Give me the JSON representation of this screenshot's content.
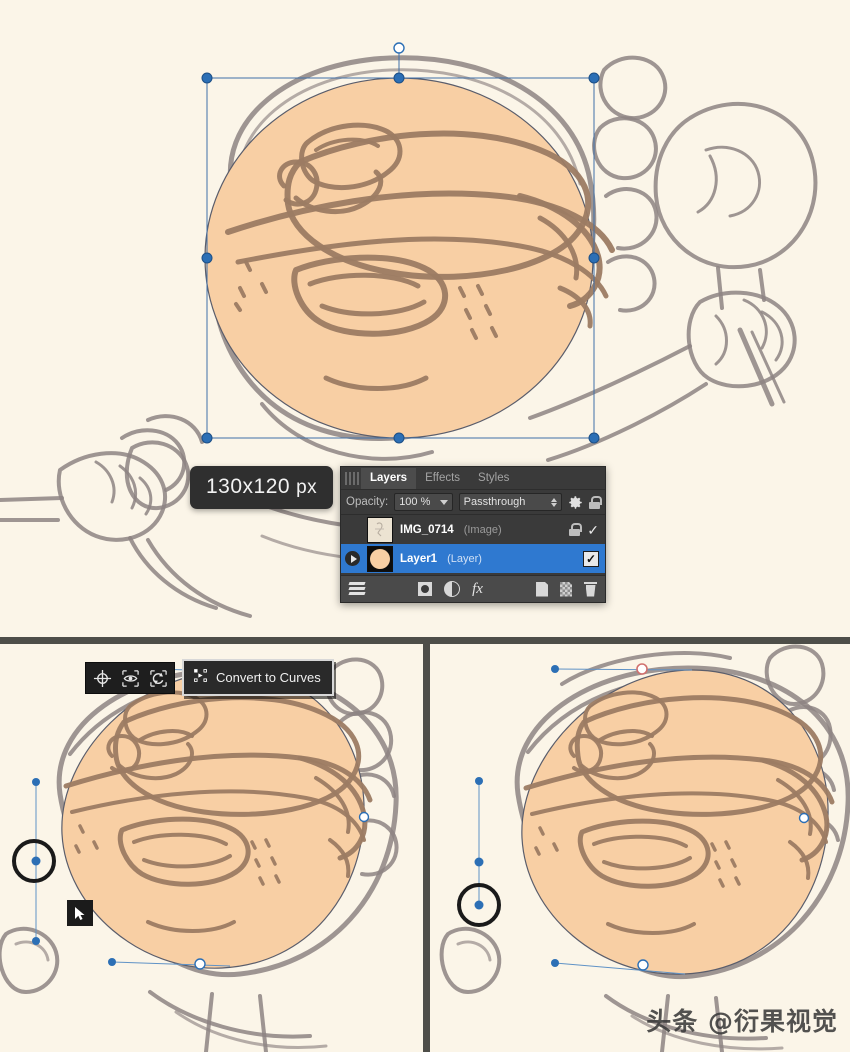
{
  "canvas": {
    "background_color": "#fbf5e8",
    "shape_fill_color": "#f8cfa4",
    "shape_stroke_color": "#5a5d6b",
    "divider_color": "#4e4e49",
    "selection_color": "#2c6fb5"
  },
  "size_tooltip": {
    "dimensions": "130x120",
    "unit": "px"
  },
  "layers_panel": {
    "tabs": [
      {
        "label": "Layers",
        "active": true
      },
      {
        "label": "Effects",
        "active": false
      },
      {
        "label": "Styles",
        "active": false
      }
    ],
    "opacity_label": "Opacity:",
    "opacity_value": "100 %",
    "blend_mode": "Passthrough",
    "gear_icon": "gear-icon",
    "lock_icon": "lock-icon",
    "rows": [
      {
        "name": "IMG_0714",
        "kind": "(Image)",
        "selected": false,
        "has_expander": false,
        "locked": true,
        "visible": true,
        "thumb": "sketch-thumbnail"
      },
      {
        "name": "Layer1",
        "kind": "(Layer)",
        "selected": true,
        "has_expander": true,
        "locked": false,
        "visible": true,
        "thumb": "circle-thumbnail"
      }
    ],
    "footer_icons": [
      "layers-stack-icon",
      "mask-icon",
      "adjustment-icon",
      "fx-icon",
      "new-layer-icon",
      "new-pixel-layer-icon",
      "delete-layer-icon"
    ]
  },
  "mini_toolbar": {
    "buttons": [
      {
        "icon": "transform-origin-icon",
        "label": ""
      },
      {
        "icon": "show-bounds-icon",
        "label": ""
      },
      {
        "icon": "cycle-handles-icon",
        "label": ""
      }
    ],
    "convert_button": {
      "icon": "convert-to-curves-icon",
      "label": "Convert to Curves"
    }
  },
  "cursors": {
    "arrow_icon": "arrow-cursor-icon"
  },
  "watermark": {
    "text": "头条 @衍果视觉"
  },
  "panes": [
    {
      "name": "top-canvas-pane"
    },
    {
      "name": "bottom-left-canvas-pane"
    },
    {
      "name": "bottom-right-canvas-pane"
    }
  ]
}
